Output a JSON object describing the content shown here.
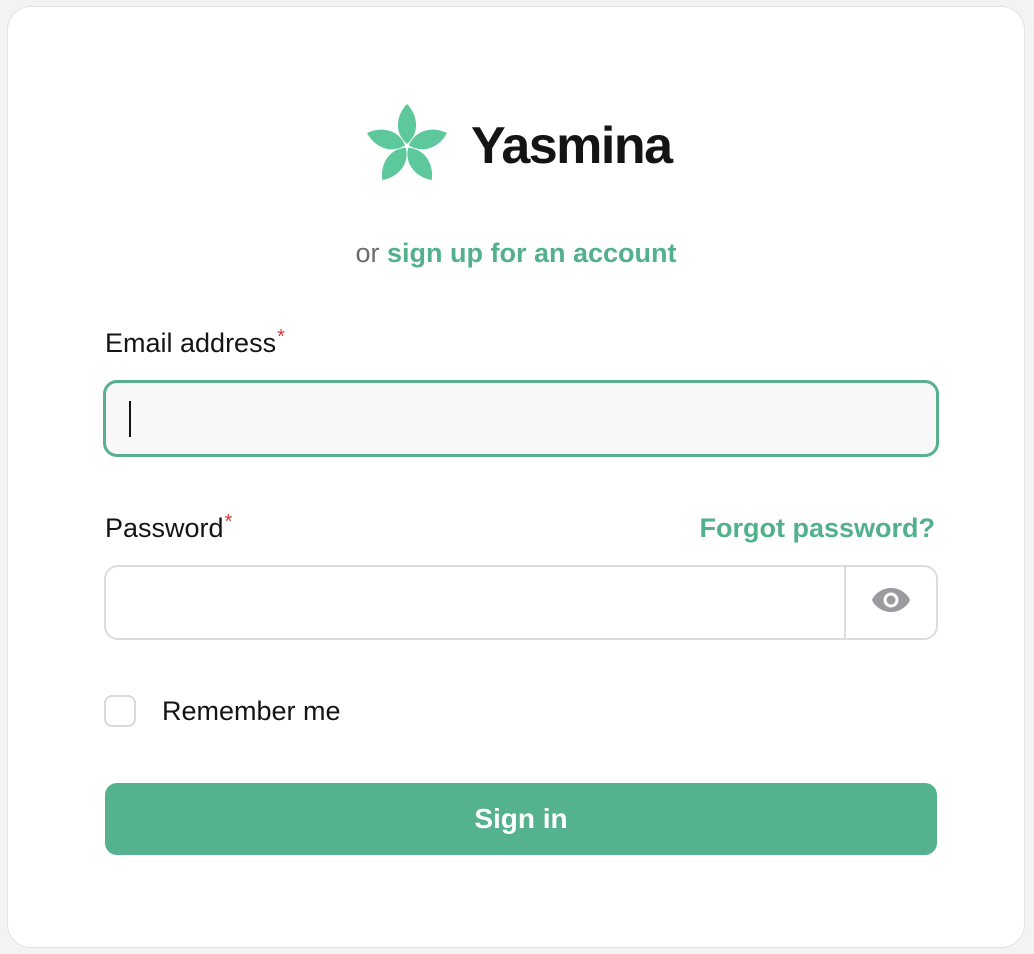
{
  "brand": {
    "name": "Yasmina",
    "logo_icon": "flower-icon",
    "accent_color": "#52b08b"
  },
  "signup": {
    "prefix": "or",
    "link_label": "sign up for an account"
  },
  "email": {
    "label": "Email address",
    "required_mark": "*",
    "value": ""
  },
  "password": {
    "label": "Password",
    "required_mark": "*",
    "forgot_label": "Forgot password?",
    "value": "",
    "toggle_icon": "eye-icon"
  },
  "remember": {
    "label": "Remember me",
    "checked": false
  },
  "submit": {
    "label": "Sign in",
    "color": "#54b28e"
  }
}
